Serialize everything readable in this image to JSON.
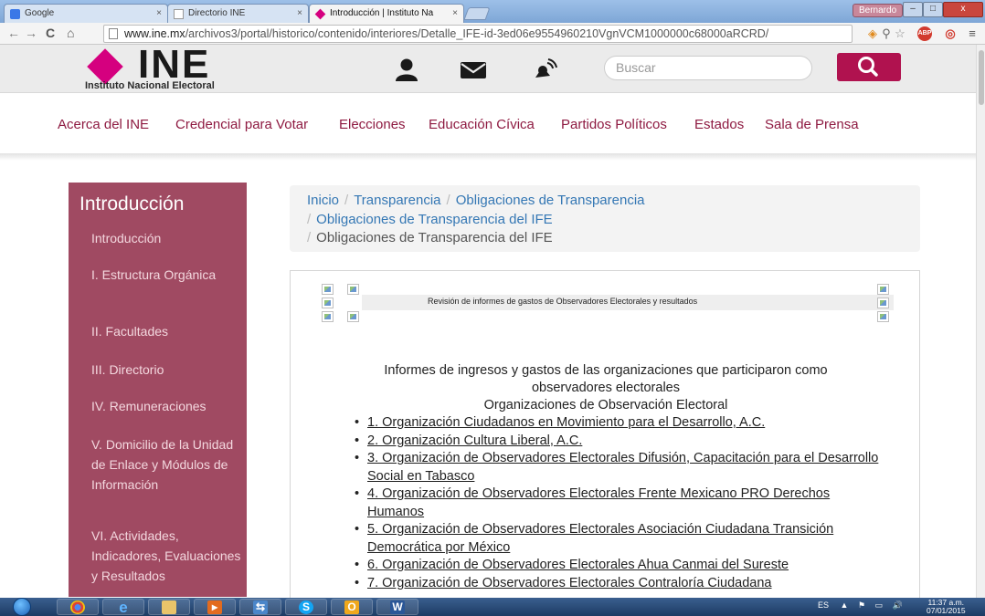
{
  "browser": {
    "tabs": [
      {
        "title": "Google",
        "active": false
      },
      {
        "title": "Directorio INE",
        "active": false
      },
      {
        "title": "Introducción | Instituto Na",
        "active": true
      }
    ],
    "user_button": "Bernardo",
    "window_controls": {
      "min": "–",
      "max": "□",
      "close": "x"
    },
    "address": {
      "host": "www.ine.mx",
      "path": "/archivos3/portal/historico/contenido/interiores/Detalle_IFE-id-3ed06e9554960210VgnVCM1000000c68000aRCRD/"
    },
    "icons": [
      "back-arrow-icon",
      "forward-arrow-icon",
      "reload-icon",
      "home-icon",
      "page-icon",
      "translate-icon",
      "zoom-icon",
      "bookmark-star-icon",
      "adblock-icon",
      "extension-icon",
      "menu-icon"
    ]
  },
  "site": {
    "logo_text": "INE",
    "logo_subtitle": "Instituto Nacional Electoral",
    "search_placeholder": "Buscar",
    "header_icons": [
      "user-icon",
      "mail-icon",
      "satellite-icon",
      "search-icon"
    ],
    "brand_color": "#b0124f",
    "nav": [
      "Acerca del INE",
      "Credencial para Votar",
      "Elecciones",
      "Educación Cívica",
      "Partidos Políticos",
      "Estados",
      "Sala de Prensa"
    ]
  },
  "sidebar": {
    "title": "Introducción",
    "items": [
      "Introducción",
      "I. Estructura Orgánica",
      "II. Facultades",
      "III. Directorio",
      "IV. Remuneraciones",
      "V. Domicilio de la Unidad de Enlace y Módulos de Información",
      "VI. Actividades, Indicadores, Evaluaciones y Resultados"
    ],
    "color": "#a04a62"
  },
  "breadcrumb": {
    "items": [
      "Inicio",
      "Transparencia",
      "Obligaciones de Transparencia",
      "Obligaciones de Transparencia del IFE"
    ],
    "current": "Obligaciones de Transparencia del IFE",
    "separator": "/"
  },
  "content": {
    "banner_caption": "Revisión de informes de gastos de Observadores Electorales y resultados",
    "heading_line1": "Informes de ingresos y gastos de las organizaciones que participaron como",
    "heading_line2": "observadores electorales",
    "subheading": "Organizaciones de Observación Electoral",
    "organizations": [
      "1. Organización Ciudadanos en Movimiento para el Desarrollo, A.C.",
      "2. Organización Cultura Liberal, A.C.",
      "3. Organización de Observadores Electorales Difusión, Capacitación para el Desarrollo Social en Tabasco",
      "4. Organización de Observadores Electorales Frente Mexicano PRO Derechos Humanos",
      "5. Organización de Observadores Electorales Asociación Ciudadana Transición Democrática por México",
      "6. Organización de Observadores Electorales Ahua Canmai del Sureste",
      "7. Organización de Observadores Electorales Contraloría Ciudadana"
    ]
  },
  "taskbar": {
    "apps": [
      "chrome-icon",
      "internet-explorer-icon",
      "file-explorer-icon",
      "media-player-icon",
      "remote-desktop-icon",
      "skype-icon",
      "outlook-icon",
      "word-icon"
    ],
    "language": "ES",
    "time": "11:37 a.m.",
    "date": "07/01/2015"
  }
}
